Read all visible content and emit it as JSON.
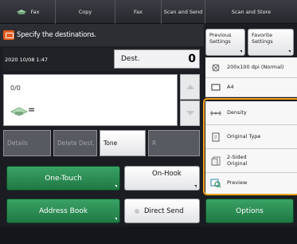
{
  "tabs": [
    {
      "label": "Fax",
      "icon": "fax-machine-icon"
    },
    {
      "label": "Copy"
    },
    {
      "label": "Fax"
    },
    {
      "label": "Scan and Send"
    },
    {
      "label": "Scan and Store"
    }
  ],
  "header": {
    "message": "Specify the destinations.",
    "icon": "warning-icon"
  },
  "top_right": {
    "previous_settings": "Previous Settings",
    "favorite_settings": "Favorite Settings"
  },
  "status": {
    "datetime": "2020 10/08 1:47",
    "dest_label": "Dest.",
    "dest_count": "0"
  },
  "destinations": {
    "fraction": "0/0",
    "icon": "fax-destination-icon",
    "value": "="
  },
  "actions": {
    "details": "Details",
    "delete_dest": "Delete Dest.",
    "tone": "Tone",
    "r": "R"
  },
  "buttons": {
    "one_touch": "One-Touch",
    "on_hook": "On-Hook",
    "address_book": "Address Book",
    "direct_send": "Direct Send",
    "options": "Options"
  },
  "settings": [
    {
      "label": "200x100 dpi (Normal)",
      "icon": "resolution-icon"
    },
    {
      "label": "A4",
      "icon": "paper-size-icon"
    },
    {
      "label": "Density",
      "icon": "density-icon"
    },
    {
      "label": "Original Type",
      "icon": "original-type-icon"
    },
    {
      "label": "2-Sided Original",
      "icon": "two-sided-icon"
    },
    {
      "label": "Preview",
      "icon": "preview-icon"
    }
  ],
  "colors": {
    "accent_green": "#2a8c52",
    "highlight_orange": "#f1a31b",
    "warning": "#e35a1d"
  }
}
